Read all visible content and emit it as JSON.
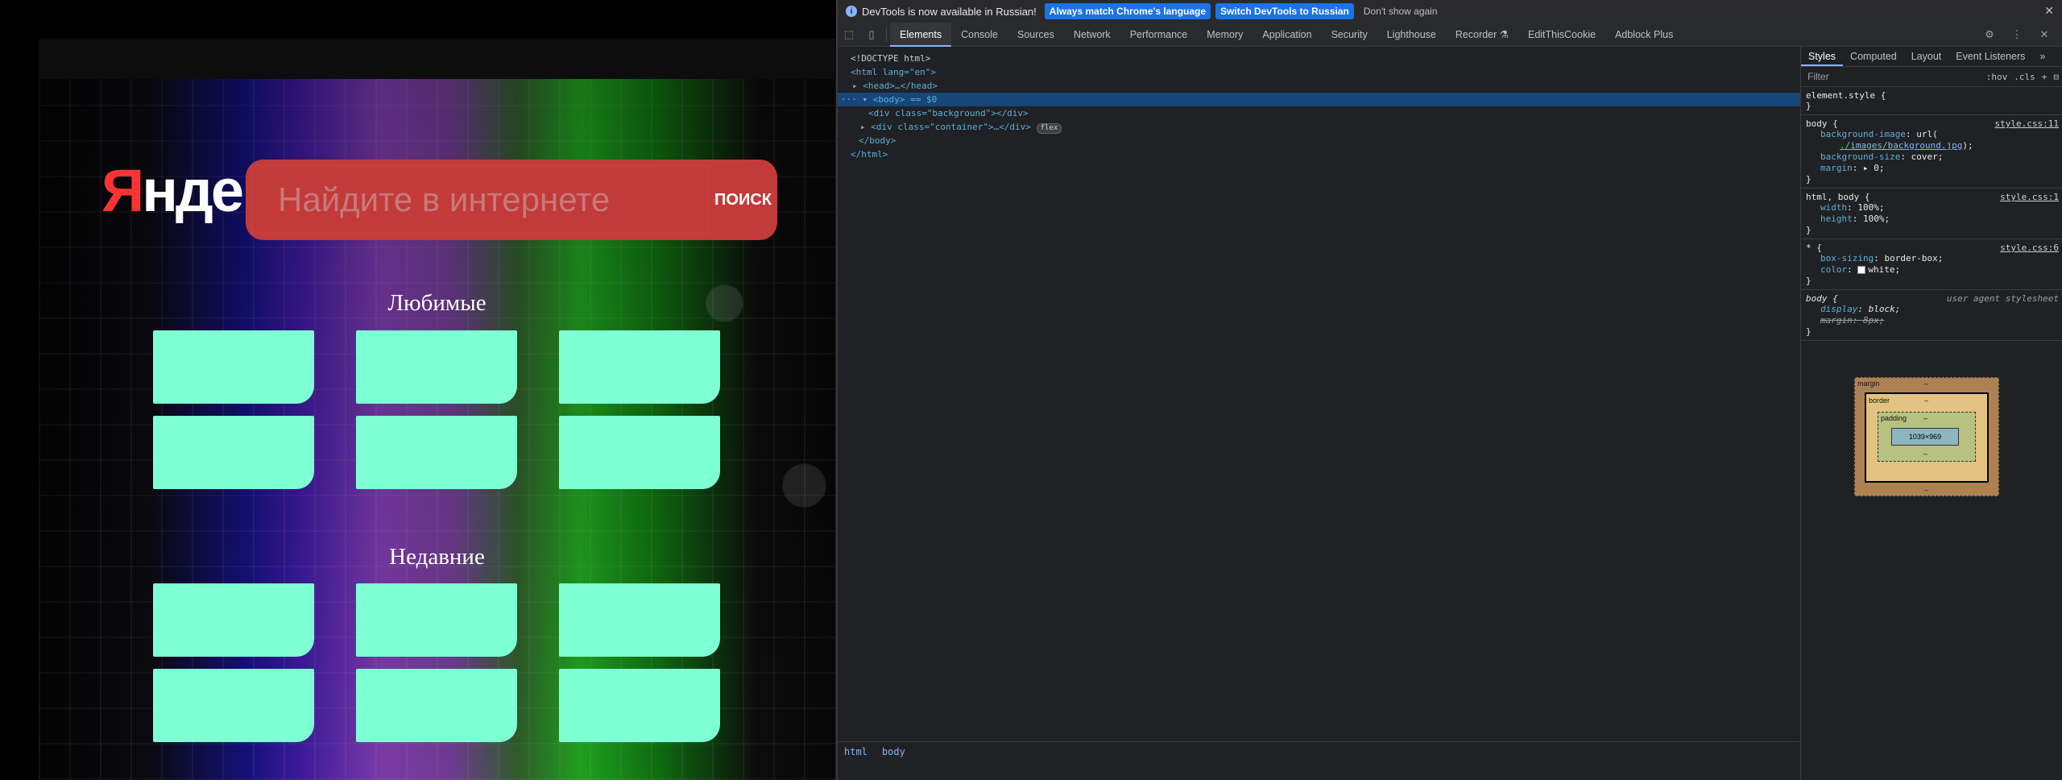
{
  "page": {
    "logo": {
      "first": "Я",
      "rest": "ндекс"
    },
    "search": {
      "placeholder": "Найдите в интернете",
      "button": "ПОИСК"
    },
    "sections": [
      {
        "title": "Любимые",
        "tile_count": 6
      },
      {
        "title": "Недавние",
        "tile_count": 6
      }
    ],
    "colors": {
      "tile": "#7fffd4",
      "search_accent": "#c23a3a"
    }
  },
  "devtools": {
    "infobar": {
      "text": "DevTools is now available in Russian!",
      "btn_match": "Always match Chrome's language",
      "btn_switch": "Switch DevTools to Russian",
      "dismiss": "Don't show again"
    },
    "tabs": [
      "Elements",
      "Console",
      "Sources",
      "Network",
      "Performance",
      "Memory",
      "Application",
      "Security",
      "Lighthouse",
      "Recorder ⚗",
      "EditThisCookie",
      "Adblock Plus"
    ],
    "active_tab": "Elements",
    "dom": {
      "doctype": "<!DOCTYPE html>",
      "html_open": "<html lang=\"en\">",
      "head": "<head>…</head>",
      "body": "<body> == $0",
      "div_bg": "<div class=\"background\"></div>",
      "div_container": "<div class=\"container\">…</div>",
      "flex_badge": "flex",
      "body_close": "</body>",
      "html_close": "</html>"
    },
    "breadcrumbs": [
      "html",
      "body"
    ],
    "side_tabs": [
      "Styles",
      "Computed",
      "Layout",
      "Event Listeners",
      "»"
    ],
    "filter": {
      "placeholder": "Filter",
      "hov": ":hov",
      "cls": ".cls"
    },
    "rules": {
      "element_style": {
        "selector": "element.style {"
      },
      "body1": {
        "selector": "body {",
        "source": "style.css:11",
        "bg_image_prop": "background-image",
        "bg_image_val": "url(",
        "bg_image_link": "./images/background.jpg",
        "bg_image_end": ");",
        "bg_size_prop": "background-size",
        "bg_size_val": "cover;",
        "margin_prop": "margin",
        "margin_val": "▸ 0;"
      },
      "html_body": {
        "selector": "html, body {",
        "source": "style.css:1",
        "width_prop": "width",
        "width_val": "100%;",
        "height_prop": "height",
        "height_val": "100%;"
      },
      "star": {
        "selector": "* {",
        "source": "style.css:6",
        "box_prop": "box-sizing",
        "box_val": "border-box;",
        "color_prop": "color",
        "color_val": "white;"
      },
      "body_ua": {
        "selector": "body {",
        "source": "user agent stylesheet",
        "display_prop": "display",
        "display_val": "block;",
        "margin_prop": "margin",
        "margin_val": "8px;"
      }
    },
    "box_model": {
      "margin": "margin",
      "border": "border",
      "padding": "padding",
      "content": "1039×969",
      "dash": "–"
    }
  }
}
